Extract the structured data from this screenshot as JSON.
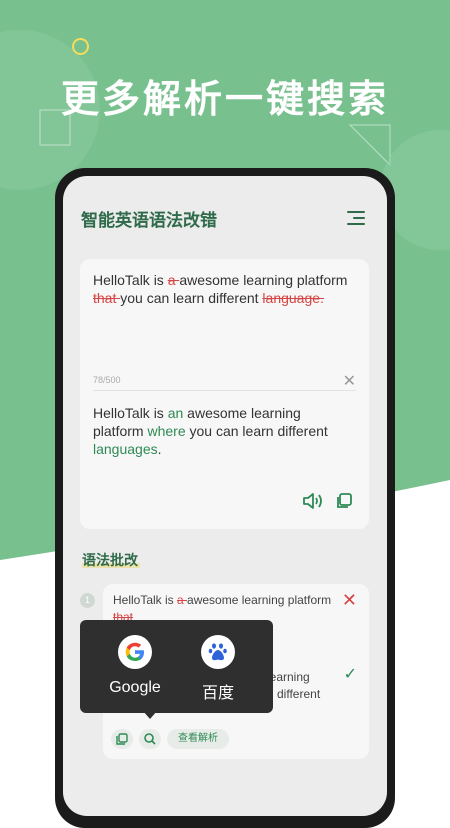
{
  "promo": {
    "title": "更多解析一键搜索"
  },
  "app": {
    "title": "智能英语语法改错"
  },
  "input": {
    "seg1": "HelloTalk is ",
    "del1": "a ",
    "seg2": "awesome learning platform ",
    "del2": "that ",
    "seg3": "you can learn different ",
    "del3": "language.",
    "counter": "78/500",
    "clear_icon": "✕"
  },
  "output": {
    "seg1": "HelloTalk is ",
    "ins1": "an",
    "seg2": " awesome learning platform ",
    "ins2": "where",
    "seg3": " you can learn different ",
    "ins3": "languages",
    "seg4": "."
  },
  "section": {
    "title": "语法批改"
  },
  "correction": {
    "index": "1",
    "line1_seg1": "HelloTalk is ",
    "line1_del": "a ",
    "line1_seg2": "awesome learning platform ",
    "line1_del2": "that",
    "wrong_icon": "✕",
    "line2_tail": "learning",
    "line2_tail2": "n different",
    "right_icon": "✓",
    "analysis_label": "查看解析"
  },
  "popup": {
    "items": [
      {
        "label": "Google"
      },
      {
        "label": "百度"
      }
    ]
  },
  "colors": {
    "brand_green": "#2f6b4a",
    "accent_green": "#2d8a54",
    "error_red": "#d64545",
    "bg_green": "#79c08f"
  }
}
